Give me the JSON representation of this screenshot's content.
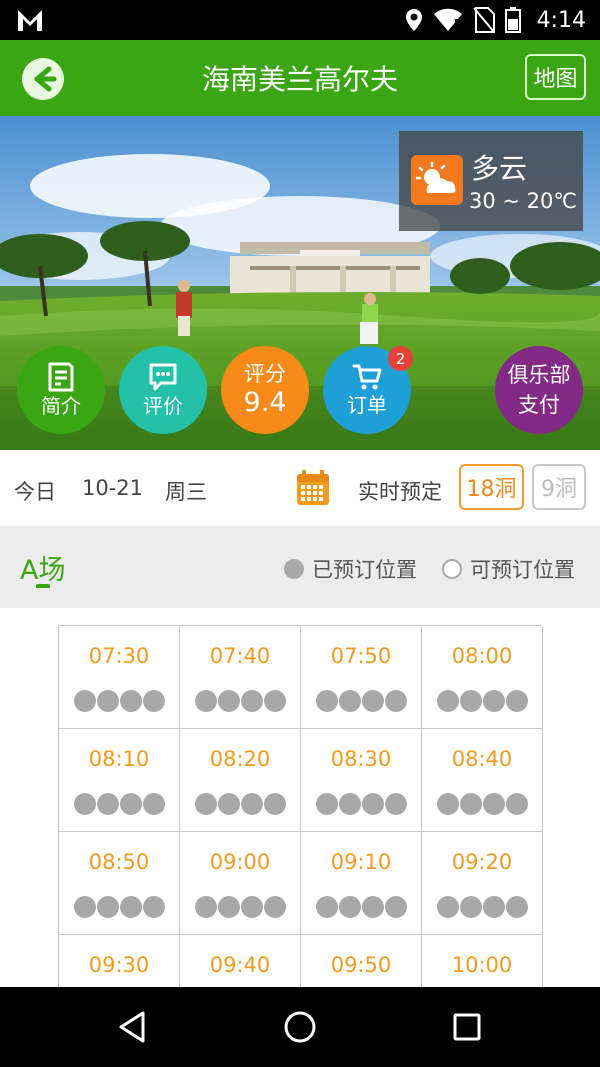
{
  "status_bar": {
    "time": "4:14",
    "icons": [
      "gmail-icon",
      "location-icon",
      "wifi-icon",
      "no-sim-icon",
      "battery-icon"
    ]
  },
  "header": {
    "title": "海南美兰高尔夫",
    "map_label": "地图",
    "back_icon": "back-arrow-icon"
  },
  "weather": {
    "condition": "多云",
    "temperature": "30 ~ 20℃",
    "icon": "partly-cloudy-icon"
  },
  "actions": {
    "intro_label": "简介",
    "review_label": "评价",
    "score_label": "评分",
    "score_value": "9.4",
    "order_label": "订单",
    "order_badge": "2",
    "club_line1": "俱乐部",
    "club_line2": "支付"
  },
  "date_row": {
    "today_label": "今日",
    "date": "10-21",
    "weekday": "周三",
    "realtime_label": "实时预定",
    "holes_18": "18洞",
    "holes_9": "9洞"
  },
  "course": {
    "name": "A场",
    "legend_booked": "已预订位置",
    "legend_available": "可预订位置"
  },
  "tee_times": [
    {
      "time": "07:30",
      "booked": 4
    },
    {
      "time": "07:40",
      "booked": 4
    },
    {
      "time": "07:50",
      "booked": 4
    },
    {
      "time": "08:00",
      "booked": 4
    },
    {
      "time": "08:10",
      "booked": 4
    },
    {
      "time": "08:20",
      "booked": 4
    },
    {
      "time": "08:30",
      "booked": 4
    },
    {
      "time": "08:40",
      "booked": 4
    },
    {
      "time": "08:50",
      "booked": 4
    },
    {
      "time": "09:00",
      "booked": 4
    },
    {
      "time": "09:10",
      "booked": 4
    },
    {
      "time": "09:20",
      "booked": 4
    },
    {
      "time": "09:30",
      "booked": 4
    },
    {
      "time": "09:40",
      "booked": 4
    },
    {
      "time": "09:50",
      "booked": 4
    },
    {
      "time": "10:00",
      "booked": 4
    }
  ],
  "colors": {
    "brand_green": "#3aa613",
    "time_orange": "#f49b1c",
    "seat_gray": "#a8a8a8"
  }
}
